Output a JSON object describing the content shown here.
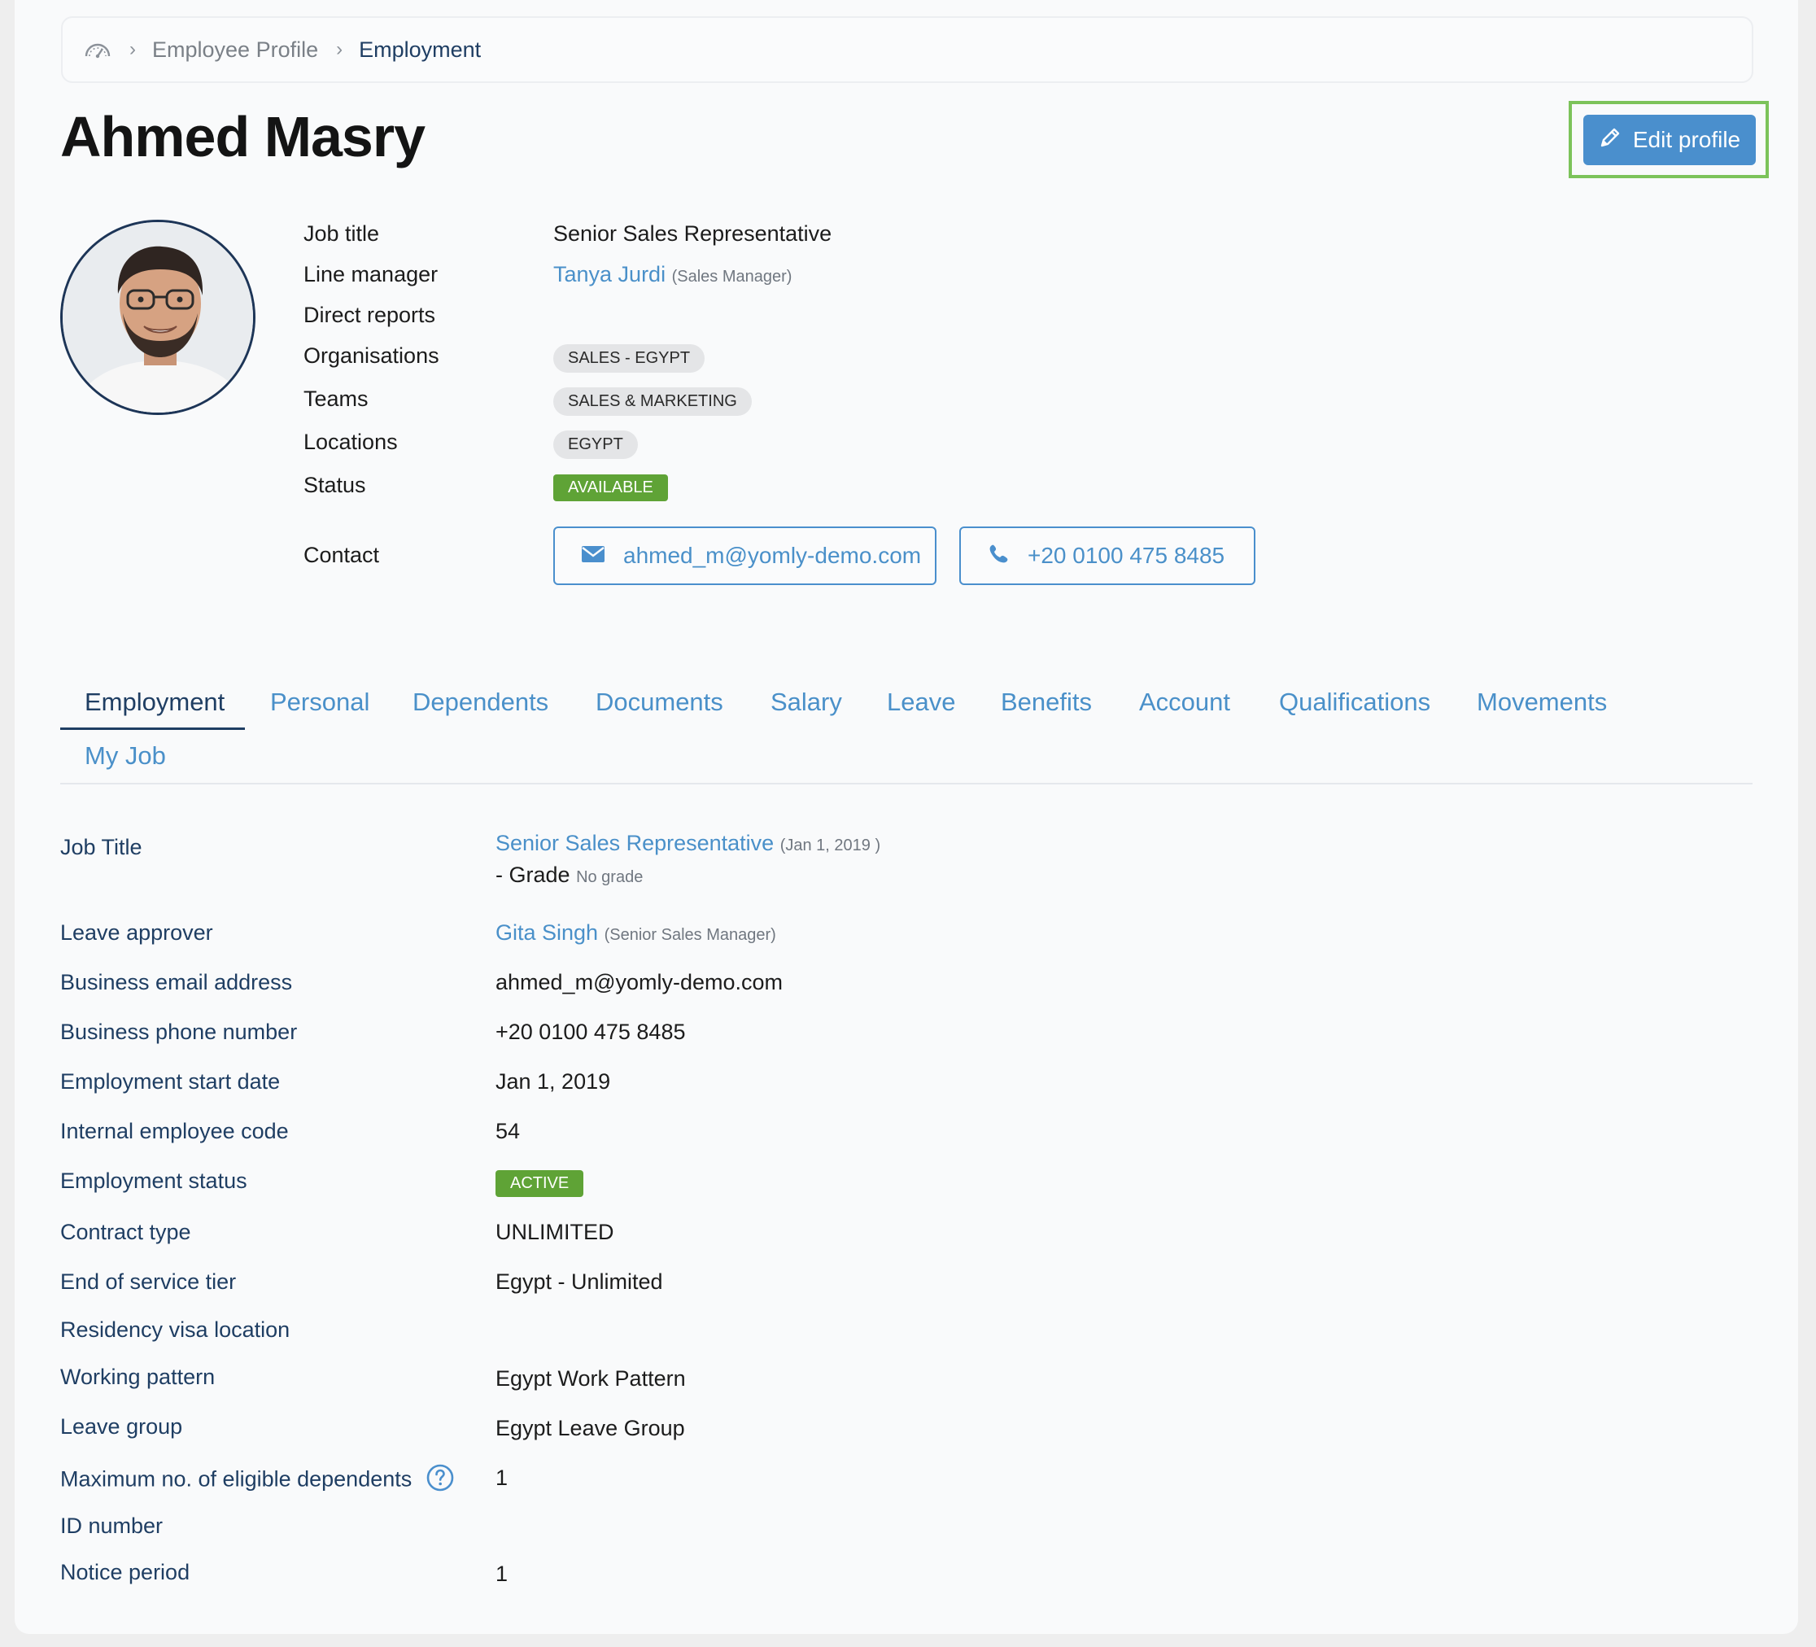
{
  "breadcrumb": {
    "home_icon": "dashboard-gauge-icon",
    "items": [
      "Employee Profile",
      "Employment"
    ]
  },
  "header": {
    "title": "Ahmed Masry",
    "edit_label": "Edit profile",
    "edit_icon": "pencil-icon"
  },
  "profile": {
    "labels": {
      "job_title": "Job title",
      "line_manager": "Line manager",
      "direct_reports": "Direct reports",
      "organisations": "Organisations",
      "teams": "Teams",
      "locations": "Locations",
      "status": "Status",
      "contact": "Contact"
    },
    "job_title": "Senior Sales Representative",
    "line_manager": {
      "name": "Tanya Jurdi",
      "role": "(Sales Manager)"
    },
    "organisations": [
      "SALES - EGYPT"
    ],
    "teams": [
      "SALES & MARKETING"
    ],
    "locations": [
      "EGYPT"
    ],
    "status": "AVAILABLE",
    "email": "ahmed_m@yomly-demo.com",
    "phone": "+20 0100 475 8485"
  },
  "tabs": [
    "Employment",
    "Personal",
    "Dependents",
    "Documents",
    "Salary",
    "Leave",
    "Benefits",
    "Account",
    "Qualifications",
    "Movements",
    "My Job"
  ],
  "active_tab": "Employment",
  "employment": {
    "job_title_label": "Job Title",
    "job_title": {
      "title": "Senior Sales Representative",
      "date": "(Jan 1, 2019 )",
      "grade_prefix": "- Grade",
      "grade": "No grade"
    },
    "leave_approver_label": "Leave approver",
    "leave_approver": {
      "name": "Gita Singh",
      "role": "(Senior Sales Manager)"
    },
    "rows": [
      {
        "label": "Business email address",
        "value": "ahmed_m@yomly-demo.com"
      },
      {
        "label": "Business phone number",
        "value": "+20 0100 475 8485"
      },
      {
        "label": "Employment start date",
        "value": "Jan 1, 2019"
      },
      {
        "label": "Internal employee code",
        "value": "54"
      },
      {
        "label": "Employment status",
        "value": "ACTIVE"
      },
      {
        "label": "Contract type",
        "value": "UNLIMITED"
      },
      {
        "label": "End of service tier",
        "value": "Egypt - Unlimited"
      },
      {
        "label": "Residency visa location",
        "value": ""
      },
      {
        "label": "Working pattern",
        "value": "Egypt Work Pattern"
      },
      {
        "label": "Leave group",
        "value": "Egypt Leave Group"
      },
      {
        "label": "Maximum no. of eligible dependents",
        "value": "1"
      },
      {
        "label": "ID number",
        "value": ""
      },
      {
        "label": "Notice period",
        "value": "1"
      }
    ]
  },
  "colors": {
    "accent": "#4a8fcd",
    "link": "#4a90c9",
    "navy": "#1f3e63",
    "success": "#5fa336",
    "highlight_frame": "#7cc35a"
  }
}
